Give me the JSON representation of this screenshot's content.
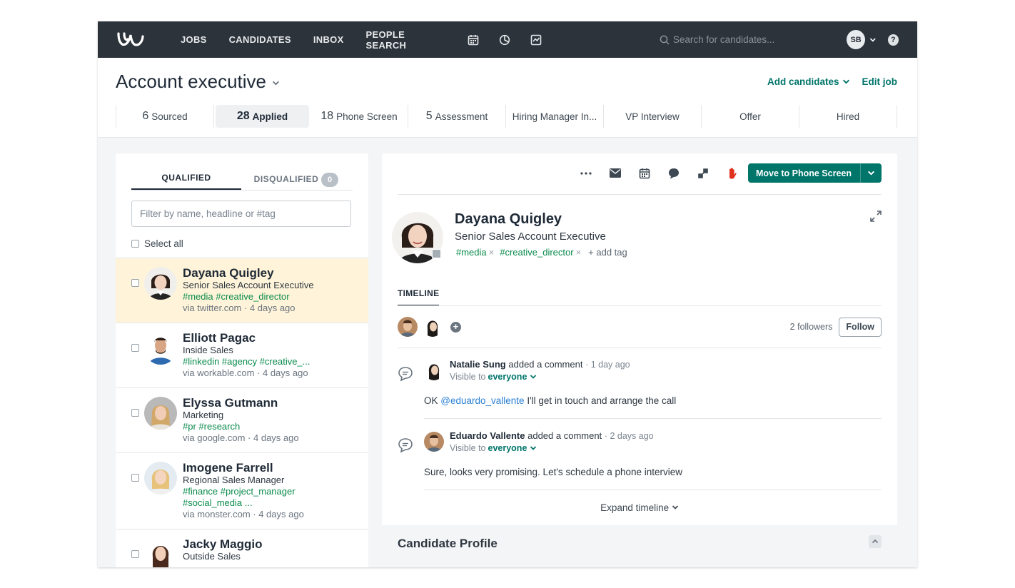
{
  "nav": {
    "links": [
      "JOBS",
      "CANDIDATES",
      "INBOX",
      "PEOPLE SEARCH"
    ],
    "icons": [
      "calendar-icon",
      "pie-chart-icon",
      "report-icon"
    ],
    "search_placeholder": "Search for candidates...",
    "user_initials": "SB",
    "help": "?"
  },
  "job": {
    "title": "Account executive",
    "add_candidates": "Add candidates",
    "edit_job": "Edit job",
    "stages": [
      {
        "count": "6",
        "label": "Sourced"
      },
      {
        "count": "28",
        "label": "Applied"
      },
      {
        "count": "18",
        "label": "Phone Screen"
      },
      {
        "count": "5",
        "label": "Assessment"
      },
      {
        "count": "",
        "label": "Hiring Manager In..."
      },
      {
        "count": "",
        "label": "VP Interview"
      },
      {
        "count": "",
        "label": "Offer"
      },
      {
        "count": "",
        "label": "Hired"
      }
    ],
    "active_stage": "Applied"
  },
  "list": {
    "tab_qualified": "QUALIFIED",
    "tab_disqualified": "DISQUALIFIED",
    "disqualified_count": "0",
    "filter_placeholder": "Filter by name, headline or #tag",
    "select_all": "Select all",
    "candidates": [
      {
        "name": "Dayana Quigley",
        "title": "Senior Sales Account Executive",
        "tags": "#media #creative_director",
        "tags2": "",
        "via": "via twitter.com · 4 days ago"
      },
      {
        "name": "Elliott Pagac",
        "title": "Inside Sales",
        "tags": "#linkedin #agency #creative_...",
        "tags2": "",
        "via": "via workable.com · 4 days ago"
      },
      {
        "name": "Elyssa Gutmann",
        "title": "Marketing",
        "tags": "#pr #research",
        "tags2": "",
        "via": "via google.com · 4 days ago"
      },
      {
        "name": "Imogene Farrell",
        "title": "Regional Sales Manager",
        "tags": "#finance #project_manager",
        "tags2": "#social_media ...",
        "via": "via monster.com · 4 days ago"
      },
      {
        "name": "Jacky Maggio",
        "title": "Outside Sales",
        "tags": "",
        "tags2": "",
        "via": ""
      }
    ]
  },
  "detail": {
    "more": "···",
    "move_button": "Move to Phone Screen",
    "name": "Dayana Quigley",
    "headline": "Senior Sales Account Executive",
    "tags": [
      "#media",
      "#creative_director"
    ],
    "add_tag": "+ add tag",
    "timeline_tab": "TIMELINE",
    "followers_count": "2 followers",
    "follow": "Follow",
    "entries": [
      {
        "author": "Natalie Sung",
        "action": "added a comment",
        "time": "· 1 day ago",
        "visible_prefix": "Visible to",
        "visible_to": "everyone",
        "mention": "@eduardo_vallente",
        "text": "OK",
        "text_after": "I'll get in touch and arrange the call"
      },
      {
        "author": "Eduardo Vallente",
        "action": "added a comment",
        "time": "· 2 days ago",
        "visible_prefix": "Visible to",
        "visible_to": "everyone",
        "mention": "",
        "text": "Sure, looks very promising. Let's schedule a phone interview",
        "text_after": ""
      }
    ],
    "expand_timeline": "Expand timeline",
    "candidate_profile": "Candidate Profile"
  },
  "colors": {
    "nav_bg": "#2c333b",
    "accent": "#00756a",
    "tag_green": "#0a8b4c",
    "selected_row": "#fff4d9",
    "mention_blue": "#2a7fd4",
    "stop_red": "#e0301e"
  }
}
